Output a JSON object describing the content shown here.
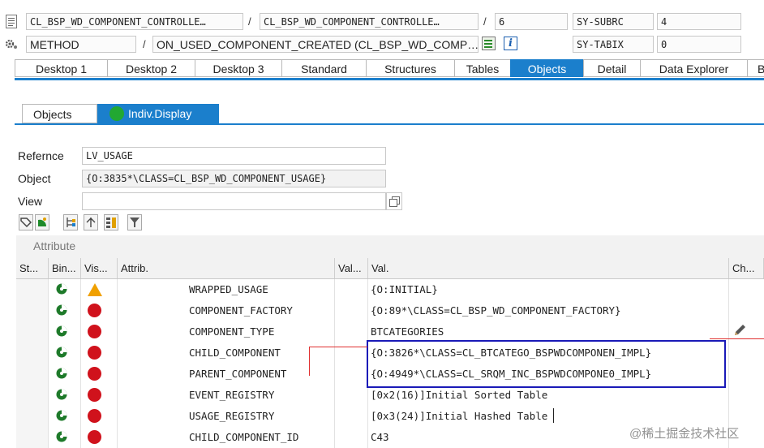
{
  "header": {
    "row1": {
      "field1": "CL_BSP_WD_COMPONENT_CONTROLLE…",
      "sep1": "/",
      "field2": "CL_BSP_WD_COMPONENT_CONTROLLE…",
      "sep2": "/",
      "line": "6",
      "sy_label": "SY-SUBRC",
      "sy_value": "4"
    },
    "row2": {
      "field1": "METHOD",
      "sep1": "/",
      "field2": "ON_USED_COMPONENT_CREATED (CL_BSP_WD_COMP…",
      "sy_label": "SY-TABIX",
      "sy_value": "0"
    }
  },
  "tabs": [
    "Desktop 1",
    "Desktop 2",
    "Desktop 3",
    "Standard",
    "Structures",
    "Tables",
    "Objects",
    "Detail",
    "Data Explorer",
    "B"
  ],
  "active_tab": "Objects",
  "subtabs": {
    "objects": "Objects",
    "indiv": "Indiv.Display"
  },
  "form": {
    "reference_label": "Refernce",
    "reference_value": "LV_USAGE",
    "object_label": "Object",
    "object_value": "{O:3835*\\CLASS=CL_BSP_WD_COMPONENT_USAGE}",
    "view_label": "View",
    "view_value": ""
  },
  "grid": {
    "section_title": "Attribute",
    "headers": [
      "St...",
      "Bin...",
      "Vis...",
      "Attrib.",
      "Val...",
      "Val.",
      "Ch..."
    ],
    "rows": [
      {
        "attr": "WRAPPED_USAGE",
        "value": "{O:INITIAL}",
        "status": "warning"
      },
      {
        "attr": "COMPONENT_FACTORY",
        "value": "{O:89*\\CLASS=CL_BSP_WD_COMPONENT_FACTORY}",
        "status": "error"
      },
      {
        "attr": "COMPONENT_TYPE",
        "value": "BTCATEGORIES",
        "status": "error"
      },
      {
        "attr": "CHILD_COMPONENT",
        "value": "{O:3826*\\CLASS=CL_BTCATEGO_BSPWDCOMPONEN_IMPL}",
        "status": "error"
      },
      {
        "attr": "PARENT_COMPONENT",
        "value": "{O:4949*\\CLASS=CL_SRQM_INC_BSPWDCOMPONE0_IMPL}",
        "status": "error"
      },
      {
        "attr": "EVENT_REGISTRY",
        "value": "[0x2(16)]Initial Sorted Table",
        "status": "error"
      },
      {
        "attr": "USAGE_REGISTRY",
        "value": "[0x3(24)]Initial Hashed Table",
        "status": "error"
      },
      {
        "attr": "CHILD_COMPONENT_ID",
        "value": "C43",
        "status": "error"
      }
    ]
  },
  "watermark": "@稀土掘金技术社区",
  "colors": {
    "accent": "#1b7fcc",
    "highlight_box": "#1a1ab8",
    "error_dot": "#d0121c",
    "warning": "#f0a000",
    "annotation_line": "#e03030"
  }
}
